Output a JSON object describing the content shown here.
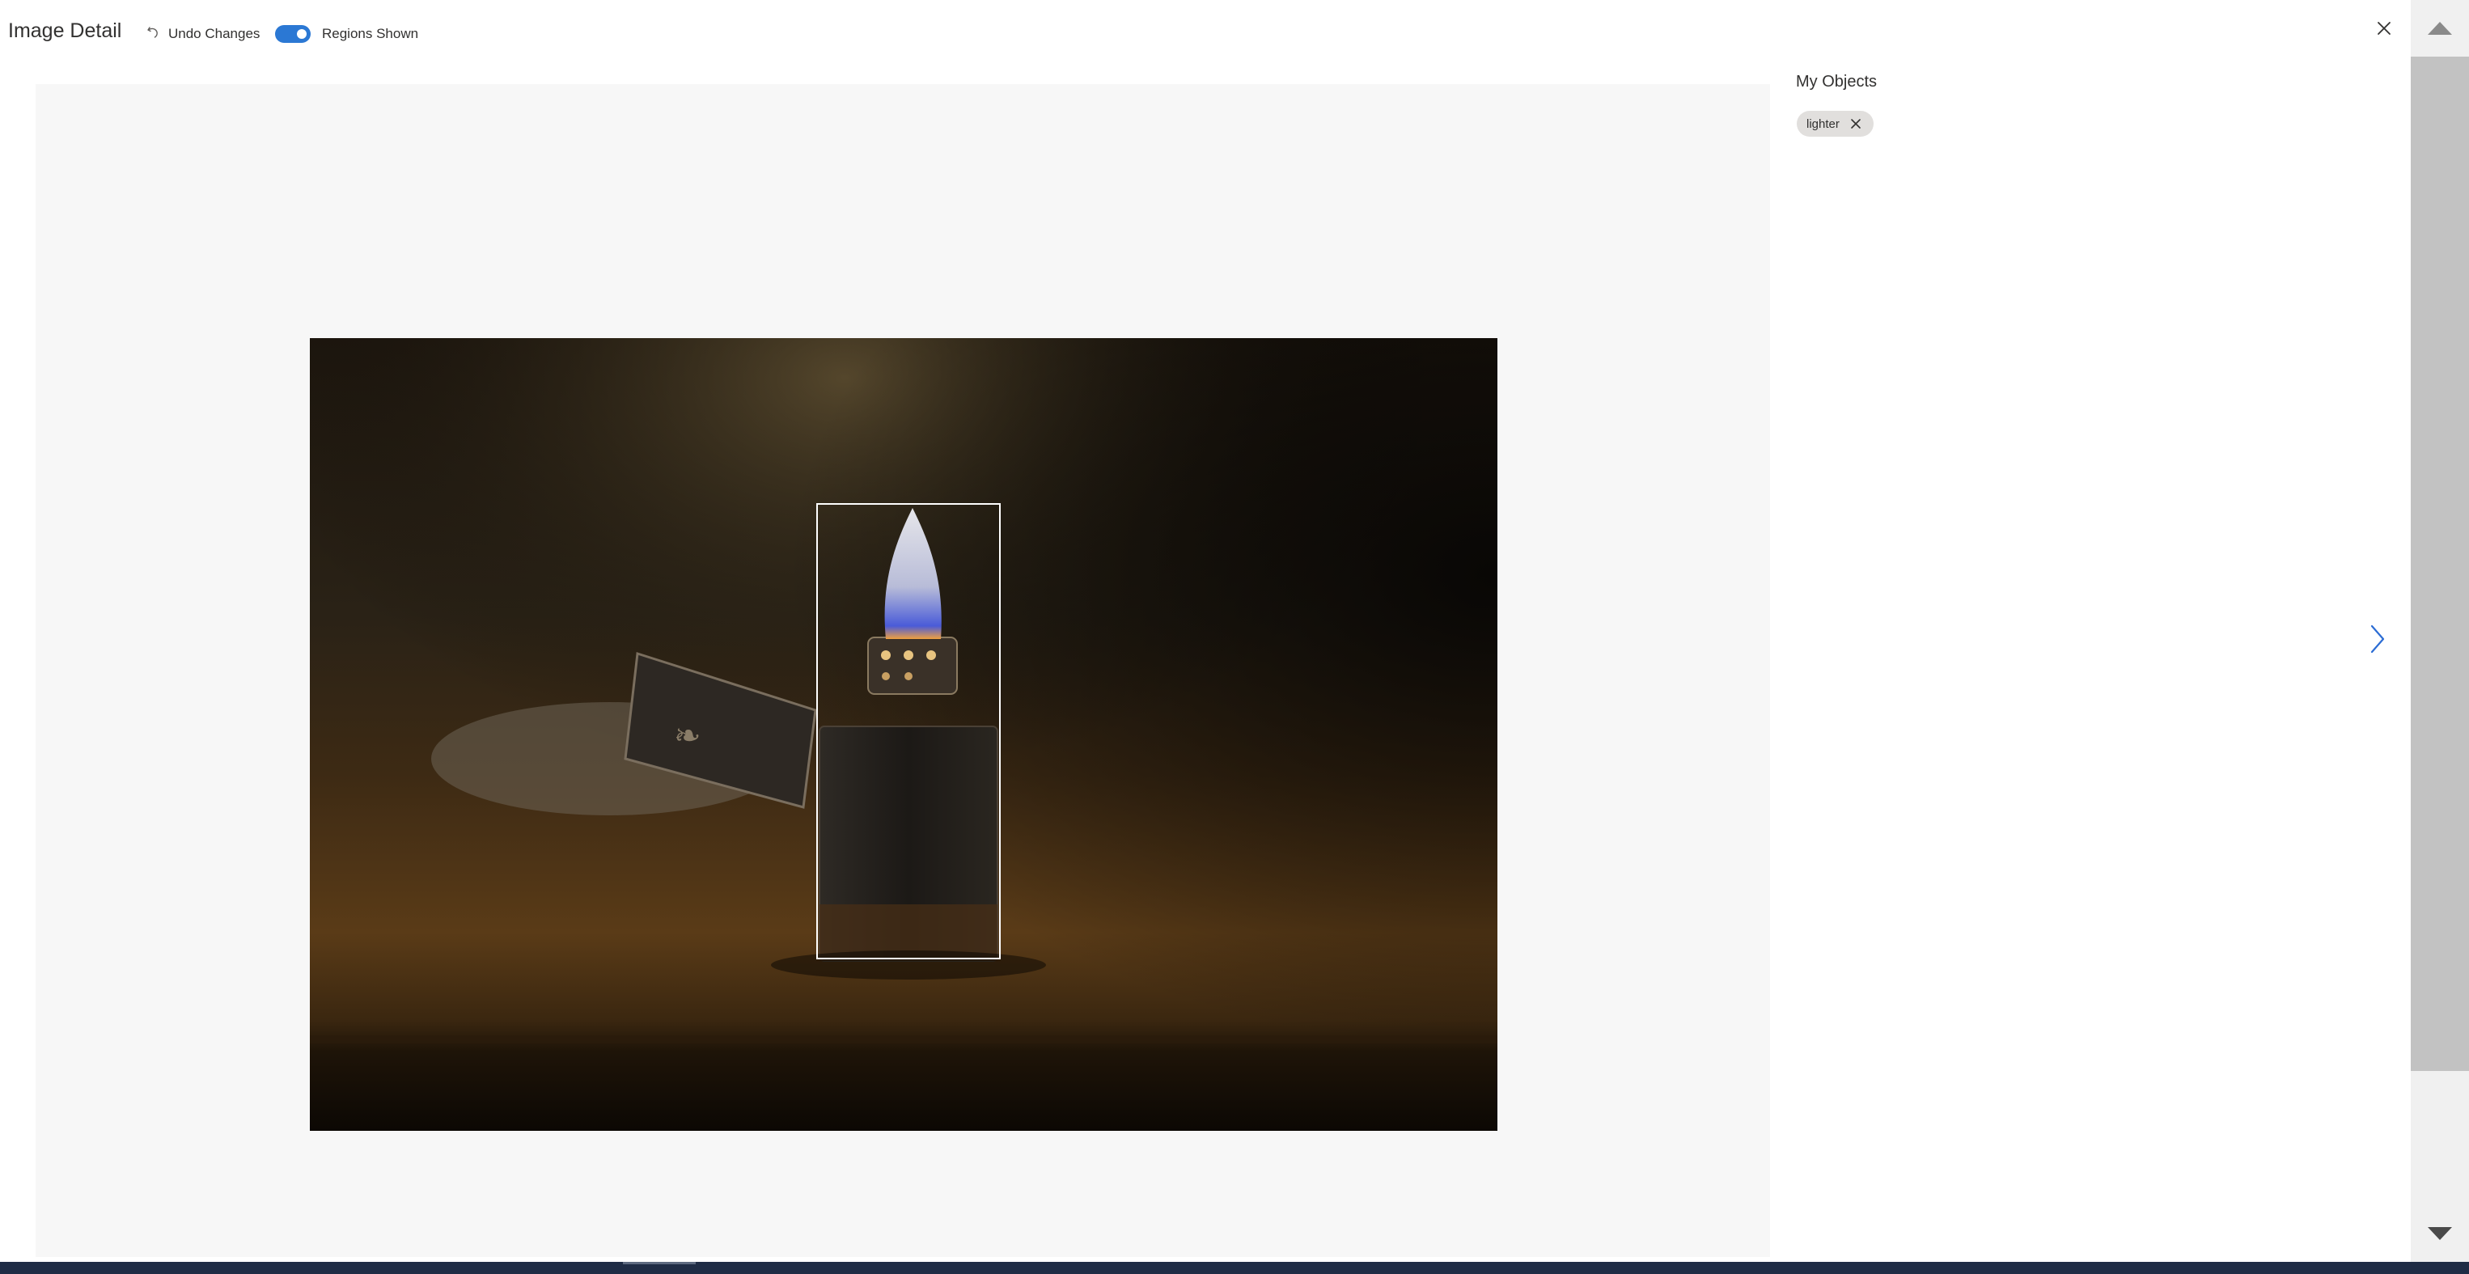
{
  "header": {
    "title": "Image Detail",
    "undo_label": "Undo Changes",
    "regions_toggle_label": "Regions Shown",
    "regions_toggle_on": true
  },
  "panel": {
    "title": "My Objects",
    "tags": [
      {
        "label": "lighter"
      }
    ]
  },
  "colors": {
    "accent": "#2b78d4",
    "stage_background": "#f7f7f7",
    "chip_background": "#e1dfdd",
    "scrollbar_thumb": "#c2c2c2"
  },
  "icons": {
    "undo": "undo-icon",
    "close": "close-icon",
    "next": "chevron-right-icon",
    "remove_tag": "close-icon",
    "scroll_up": "triangle-up-icon",
    "scroll_down": "triangle-down-icon"
  }
}
